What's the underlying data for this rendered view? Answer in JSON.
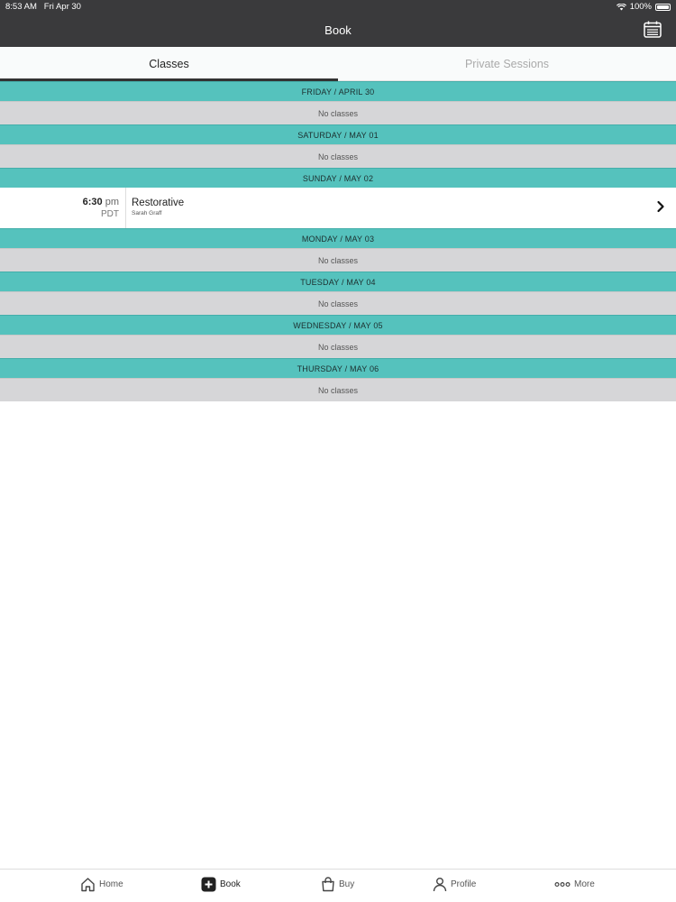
{
  "status_bar": {
    "time": "8:53 AM",
    "date": "Fri Apr 30",
    "battery": "100%",
    "wifi_icon": "wifi-icon",
    "battery_icon": "battery-icon"
  },
  "header": {
    "title": "Book",
    "calendar_icon": "calendar-icon"
  },
  "tabs": [
    {
      "label": "Classes",
      "active": true
    },
    {
      "label": "Private Sessions",
      "active": false
    }
  ],
  "schedule": {
    "days": [
      {
        "label": "FRIDAY / APRIL 30",
        "empty_text": "No classes"
      },
      {
        "label": "SATURDAY / MAY 01",
        "empty_text": "No classes"
      },
      {
        "label": "SUNDAY / MAY 02",
        "class": {
          "time": "6:30",
          "ampm": "pm",
          "tz": "PDT",
          "name": "Restorative",
          "instructor": "Sarah Graff"
        }
      },
      {
        "label": "MONDAY / MAY 03",
        "empty_text": "No classes"
      },
      {
        "label": "TUESDAY / MAY 04",
        "empty_text": "No classes"
      },
      {
        "label": "WEDNESDAY / MAY 05",
        "empty_text": "No classes"
      },
      {
        "label": "THURSDAY / MAY 06",
        "empty_text": "No classes"
      }
    ]
  },
  "tabbar": [
    {
      "label": "Home",
      "icon": "home-icon"
    },
    {
      "label": "Book",
      "icon": "plus-square-icon",
      "active": true
    },
    {
      "label": "Buy",
      "icon": "shopping-bag-icon"
    },
    {
      "label": "Profile",
      "icon": "person-icon"
    },
    {
      "label": "More",
      "icon": "more-dots-icon"
    }
  ],
  "colors": {
    "nav_bg": "#3a3a3c",
    "day_header": "#55c2bd",
    "no_class_bg": "#d6d6d8"
  }
}
